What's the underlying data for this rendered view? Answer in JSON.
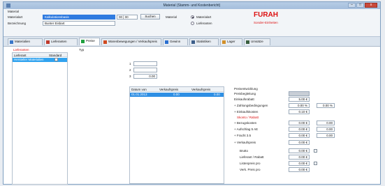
{
  "window": {
    "title": "Material (Stamm- und Kostenbericht)",
    "close_label": "x"
  },
  "header": {
    "section_label": "Material",
    "rows": [
      {
        "label": "Materialart",
        "value": "Kalkulationsbasis"
      },
      {
        "label": "Bezeichnung",
        "value": "Bunter Eisbart"
      }
    ],
    "code_value": "00 | 00",
    "search_button": "Suchen",
    "status_label": "Material",
    "radio1": "Materialart",
    "radio2": "Lieferanten",
    "code_big": "FURAH",
    "code_sub": "Sonder-Einheiten"
  },
  "tabs": [
    {
      "label": "Materialien",
      "color": "#3a77c9"
    },
    {
      "label": "Lieferanten",
      "color": "#c0392b"
    },
    {
      "label": "Preise",
      "color": "#20a040"
    },
    {
      "label": "Warenbewegungen / Verkaufspreis",
      "color": "#d04a20"
    },
    {
      "label": "Gewinn",
      "color": "#2a6fd0"
    },
    {
      "label": "Statistiken",
      "color": "#3d5f8a"
    },
    {
      "label": "Lager",
      "color": "#d2902a"
    },
    {
      "label": "Umsätze",
      "color": "#3a5f3f"
    }
  ],
  "left_panel": {
    "header_red": "Lieferanten",
    "columns": [
      "Lieferant",
      "Standard"
    ],
    "selected_row": "Hersteller Materialien"
  },
  "middle_inputs": {
    "label": "Typ",
    "fields": [
      "1",
      "2",
      "3"
    ],
    "field3_value": "0.00"
  },
  "table": {
    "columns": [
      "Datum von",
      "Verkaufspreis",
      "Verkaufspreis"
    ],
    "rows": [
      [
        "01.01.2013",
        "0.00",
        "0.00"
      ]
    ]
  },
  "calc": {
    "title": "Preisentwicklung",
    "subtitle": "Preisbegleitung",
    "lines": [
      {
        "label": "Einkaufsrabatt",
        "value": "5.00 €"
      },
      {
        "label": "+ Zahlungsbedingungen",
        "value": "0.00 %",
        "extra": "0.00 %"
      },
      {
        "label": "+ Einkaufskosten",
        "value": "0.10 €"
      },
      {
        "label": "Skonto / Rabatt",
        "value": ""
      },
      {
        "label": "+ Bezugskosten",
        "value": "0.00 €",
        "extra": "0.00"
      },
      {
        "label": "+ Aufschlag 5 AE",
        "value": "0.00 €",
        "extra": "0.00"
      },
      {
        "label": "+ Fracht 3.5",
        "value": "0.00 €",
        "extra": "0.00"
      },
      {
        "label": "+ Verkaufspreis",
        "value": "0.00 €"
      },
      {
        "label": "Brutto",
        "value": "0.00 €"
      },
      {
        "label": "Lieferant / Rabatt",
        "value": "0.00 €"
      },
      {
        "label": "Listenpreis pro",
        "value": "0.00 €"
      },
      {
        "label": "Verk. Preis pro",
        "value": "0.00 €"
      }
    ]
  }
}
